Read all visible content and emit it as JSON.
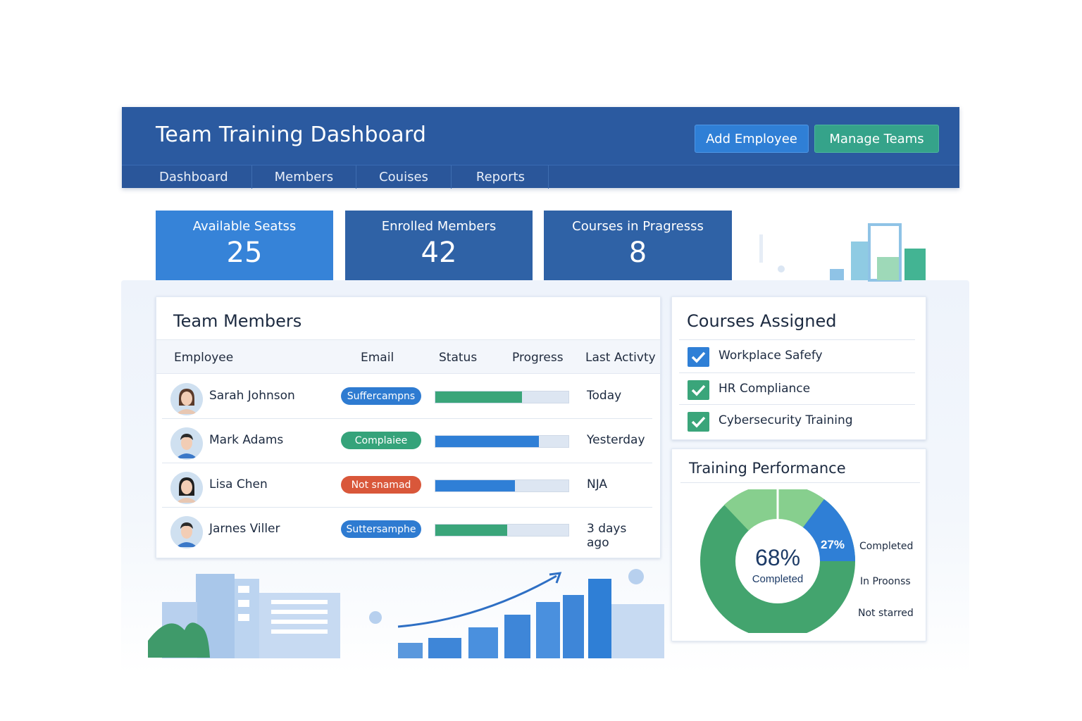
{
  "header": {
    "title": "Team Training Dashboard",
    "add_employee": "Add Employee",
    "manage_teams": "Manage Teams",
    "nav": [
      "Dashboard",
      "Members",
      "Couises",
      "Reports"
    ]
  },
  "stats": [
    {
      "label": "Available Seatss",
      "value": "25"
    },
    {
      "label": "Enrolled Members",
      "value": "42"
    },
    {
      "label": "Courses in Pragresss",
      "value": "8"
    }
  ],
  "members": {
    "title": "Team Members",
    "columns": [
      "Employee",
      "Email",
      "Status",
      "Progress",
      "Last Activty"
    ],
    "rows": [
      {
        "name": "Sarah Johnson",
        "status": "Suffercampns",
        "status_color": "#2e7bd1",
        "progress": 0.65,
        "bar_color": "#3aa57a",
        "activity": "Today"
      },
      {
        "name": "Mark Adams",
        "status": "Complaiee",
        "status_color": "#35a37a",
        "progress": 0.78,
        "bar_color": "#2f7fd6",
        "activity": "Yesterday"
      },
      {
        "name": "Lisa Chen",
        "status": "Not snamad",
        "status_color": "#d9573a",
        "progress": 0.6,
        "bar_color": "#2f7fd6",
        "activity": "NJA"
      },
      {
        "name": "Jarnes Viller",
        "status": "Suttersamphe",
        "status_color": "#2e7bd1",
        "progress": 0.54,
        "bar_color": "#3aa57a",
        "activity": "3 days ago"
      }
    ]
  },
  "courses": {
    "title": "Courses Assigned",
    "items": [
      {
        "label": "Workplace Safefy",
        "check_color": "#2f7fd6"
      },
      {
        "label": "HR Compliance",
        "check_color": "#3aa57a"
      },
      {
        "label": "Cybersecurity Training",
        "check_color": "#3aa57a"
      }
    ]
  },
  "performance": {
    "title": "Training Performance",
    "center_value": "68%",
    "center_label": "Completed",
    "segment_label": "27%",
    "legend": [
      "Completed",
      "In Proonss",
      "Not starred"
    ]
  },
  "colors": {
    "primary": "#2b5aa0",
    "accent_blue": "#2f7fd6",
    "accent_green": "#3aa57a",
    "danger": "#d9573a"
  }
}
